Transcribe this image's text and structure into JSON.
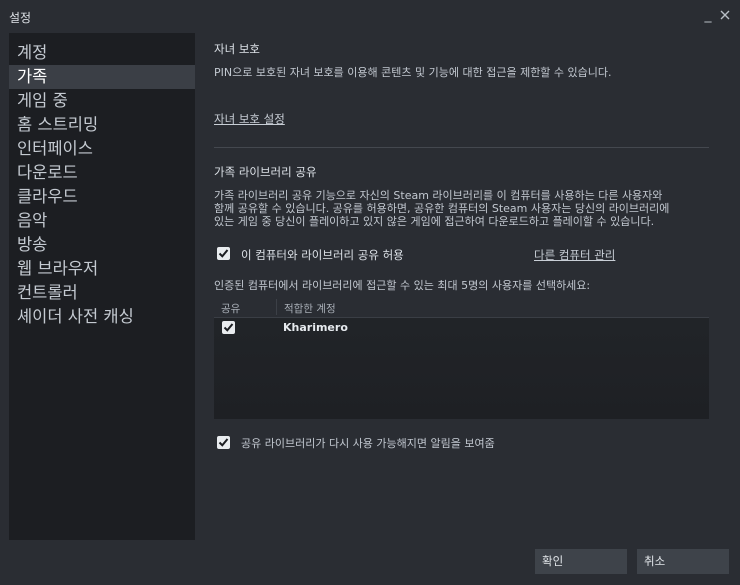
{
  "window": {
    "title": "설정",
    "min_icon": "minimize-icon",
    "close_icon": "close-icon"
  },
  "sidebar": {
    "items": [
      {
        "label": "계정"
      },
      {
        "label": "가족",
        "active": true
      },
      {
        "label": "게임 중"
      },
      {
        "label": "홈 스트리밍"
      },
      {
        "label": "인터페이스"
      },
      {
        "label": "다운로드"
      },
      {
        "label": "클라우드"
      },
      {
        "label": "음악"
      },
      {
        "label": "방송"
      },
      {
        "label": "웹 브라우저"
      },
      {
        "label": "컨트롤러"
      },
      {
        "label": "셰이더 사전 캐싱"
      }
    ]
  },
  "family_view": {
    "title": "자녀 보호",
    "description": "PIN으로 보호된 자녀 보호를 이용해 콘텐츠 및 기능에 대한 접근을 제한할 수 있습니다.",
    "link": "자녀 보호 설정"
  },
  "library_sharing": {
    "title": "가족 라이브러리 공유",
    "description_lines": [
      "가족 라이브러리 공유 기능으로 자신의 Steam 라이브러리를 이 컴퓨터를 사용하는 다른 사용자와",
      "함께 공유할 수 있습니다. 공유를 허용하면, 공유한 컴퓨터의 Steam 사용자는 당신의 라이브러리에",
      "있는 게임 중 당신이 플레이하고 있지 않은 게임에 접근하여 다운로드하고 플레이할 수 있습니다."
    ],
    "authorize_label": "이 컴퓨터와 라이브러리 공유 허용",
    "authorize_checked": true,
    "manage_link": "다른 컴퓨터 관리",
    "select_prompt": "인증된 컴퓨터에서 라이브러리에 접근할 수 있는 최대 5명의 사용자를 선택하세요:",
    "table": {
      "headers": [
        "공유",
        "적합한 계정"
      ],
      "rows": [
        {
          "shared": true,
          "account": "Kharimero"
        }
      ]
    },
    "notify_label": "공유 라이브러리가 다시 사용 가능해지면 알림을 보여줌",
    "notify_checked": true
  },
  "footer": {
    "ok_label": "확인",
    "cancel_label": "취소"
  }
}
